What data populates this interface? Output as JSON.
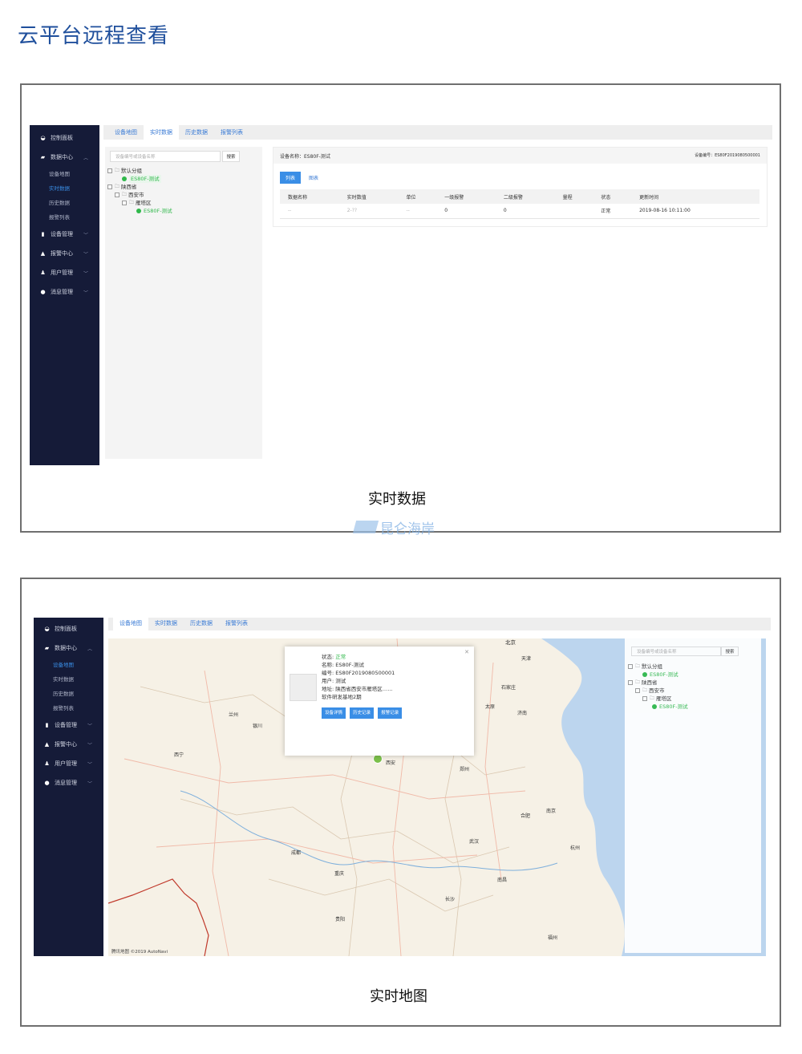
{
  "page": {
    "title": "云平台远程查看"
  },
  "captions": {
    "top": "实时数据",
    "bottom": "实时地图"
  },
  "watermark": {
    "text": "昆仑海岸"
  },
  "colors": {
    "sidebar_bg": "#151b38",
    "accent": "#3a8ee6",
    "online_green": "#2fb84a",
    "title_blue": "#1f4f9c"
  },
  "sidebar": {
    "items": [
      {
        "label": "控制面板",
        "icon": "dashboard-icon"
      },
      {
        "label": "数据中心",
        "icon": "map-icon",
        "expanded": true,
        "children": [
          "设备地图",
          "实时数据",
          "历史数据",
          "报警列表"
        ]
      },
      {
        "label": "设备管理",
        "icon": "device-icon"
      },
      {
        "label": "报警中心",
        "icon": "alarm-icon"
      },
      {
        "label": "用户管理",
        "icon": "user-icon"
      },
      {
        "label": "消息管理",
        "icon": "message-icon"
      }
    ]
  },
  "tabs": [
    "设备地图",
    "实时数据",
    "历史数据",
    "报警列表"
  ],
  "tree": {
    "search_placeholder": "设备编号或设备名称",
    "search_button": "搜索",
    "nodes": {
      "default_group": "默认分组",
      "device_green": "ES80F-测试",
      "province": "陕西省",
      "city": "西安市",
      "district": "雁塔区",
      "device": "ES80F-测试"
    }
  },
  "realtime": {
    "device_name": "设备名称：ES80F-测试",
    "device_code": "设备编号：ES80F2019080500001",
    "view_tabs": [
      "列表",
      "图表"
    ],
    "columns": [
      "数据名称",
      "实时数值",
      "单位",
      "一级报警",
      "二级报警",
      "量程",
      "状态",
      "更新时间"
    ],
    "rows": [
      [
        "--",
        "2-??",
        "--",
        "0",
        "0",
        "",
        "正常",
        "2019-08-16 10:11:00"
      ]
    ]
  },
  "map_popup": {
    "status_label": "状态:",
    "status_value": "正常",
    "name": "名称: ES80F-测试",
    "code": "编号: ES80F2019080500001",
    "user": "用户: 测试",
    "address": "地址: 陕西省西安市雁塔区……",
    "address2": "软件研发基地2期",
    "buttons": [
      "设备详情",
      "历史记录",
      "报警记录"
    ]
  },
  "map_labels": [
    "北京",
    "天津",
    "济南",
    "郑州",
    "西安",
    "成都",
    "重庆",
    "武汉",
    "合肥",
    "南京",
    "杭州",
    "长沙",
    "南昌",
    "贵阳",
    "福州",
    "西宁",
    "兰州",
    "银川",
    "太原",
    "石家庄"
  ],
  "map_footer": "腾讯地图 ©2019 AutoNavi"
}
